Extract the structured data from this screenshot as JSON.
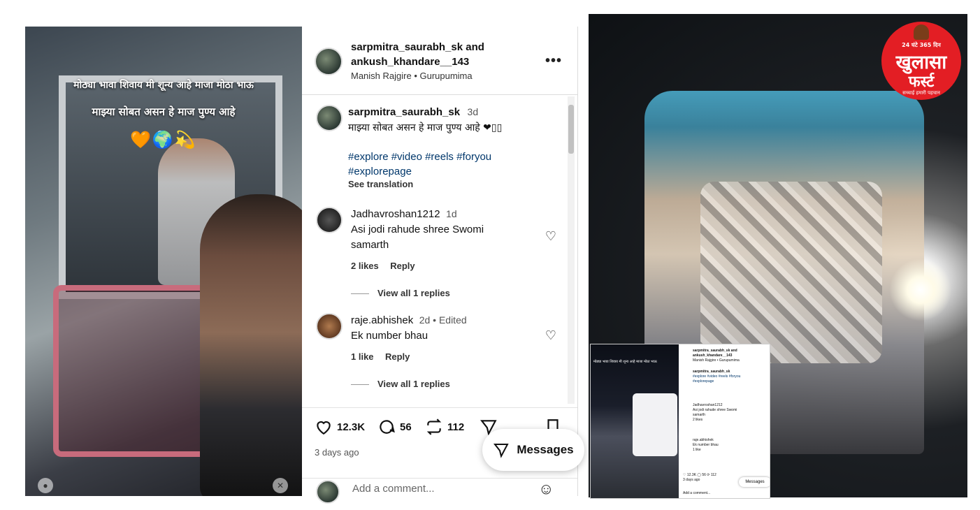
{
  "video": {
    "caption_line1": "मोठ्या भावा शिवाय मी शून्य आहे माजा मोठा भाऊ",
    "caption_line2": "माझ्या सोबत असन हे माज पुण्य आहे",
    "emojis": "🧡🌍💫"
  },
  "post": {
    "header_names_line1": "sarpmitra_saurabh_sk and",
    "header_names_line2": "ankush_khandare__143",
    "header_sub": "Manish Rajgire • Gurupumima",
    "more_label": "•••",
    "caption": {
      "username": "sarpmitra_saurabh_sk",
      "time": "3d",
      "text": "माझ्या सोबत असन हे माज पुण्य आहे ❤▯▯",
      "hashtags_line1": "#explore #video #reels #foryou",
      "hashtags_line2": "#explorepage",
      "see_translation": "See translation"
    },
    "comments": [
      {
        "username": "Jadhavroshan1212",
        "time": "1d",
        "text_line1": "Asi jodi rahude shree Swomi",
        "text_line2": "samarth",
        "likes": "2 likes",
        "reply": "Reply",
        "view_replies": "View all 1 replies"
      },
      {
        "username": "raje.abhishek",
        "time": "2d • Edited",
        "text_line1": "Ek number bhau",
        "likes": "1 like",
        "reply": "Reply",
        "view_replies": "View all 1 replies"
      }
    ],
    "actions": {
      "likes": "12.3K",
      "comments": "56",
      "reposts": "112"
    },
    "time_ago": "3 days ago",
    "add_comment_placeholder": "Add a comment...",
    "messages_label": "Messages"
  },
  "logo": {
    "tagline": "24 घंटे 365 दिन",
    "name_line1": "खुलासा",
    "name_line2": "फर्स्ट",
    "motto": "सच्चाई हमारी पहचान"
  },
  "colors": {
    "hashtag": "#00376b",
    "logo_red": "#e31e24",
    "bus_blue": "#49a7c7"
  }
}
